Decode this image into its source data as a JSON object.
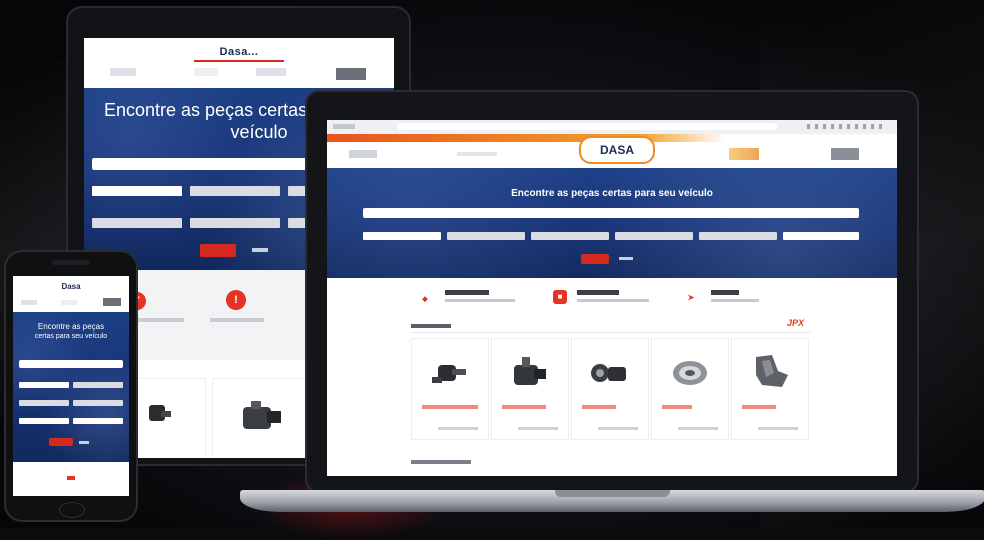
{
  "scene": {
    "background_color": "#0b0b0e",
    "accent_color": "#d72a1e",
    "brand_blue": "#1b3a80"
  },
  "tablet": {
    "logo": "Dasa...",
    "nav": [
      "",
      "",
      ""
    ],
    "hero_title_line1": "Encontre as peças certas p",
    "hero_title_line2": "veículo",
    "search_placeholder": "",
    "filters": [
      "",
      "",
      "",
      "",
      "",
      ""
    ],
    "search_button": "",
    "clear_link": "",
    "features": [
      {
        "icon": "tag-icon",
        "label": ""
      },
      {
        "icon": "info-icon",
        "label": ""
      }
    ]
  },
  "laptop": {
    "browser_url": "",
    "logo": "DASA",
    "brand_right": "",
    "hero_title": "Encontre as peças certas para seu veículo",
    "search_placeholder": "",
    "filters": [
      "",
      "",
      "",
      "",
      "",
      ""
    ],
    "search_button": "",
    "clear_link": "",
    "features": [
      {
        "icon": "tag-icon",
        "title": "",
        "text": ""
      },
      {
        "icon": "info-icon",
        "title": "",
        "text": ""
      },
      {
        "icon": "truck-icon",
        "title": "",
        "text": ""
      }
    ],
    "section_title": "",
    "section_badge": "JPX",
    "products": [
      {
        "icon": "caliper-part-icon",
        "price": "",
        "link": ""
      },
      {
        "icon": "motor-part-icon",
        "price": "",
        "link": ""
      },
      {
        "icon": "pump-part-icon",
        "price": "",
        "link": ""
      },
      {
        "icon": "bearing-part-icon",
        "price": "",
        "link": ""
      },
      {
        "icon": "bracket-part-icon",
        "price": "",
        "link": ""
      }
    ],
    "footer_section_title": ""
  },
  "phone": {
    "logo": "Dasa",
    "hero_title_line1": "Encontre as peças",
    "hero_title_line2": "certas para seu veículo",
    "search_placeholder": "",
    "filters": [
      "",
      "",
      "",
      "",
      "",
      ""
    ],
    "search_button": "",
    "clear_link": ""
  }
}
